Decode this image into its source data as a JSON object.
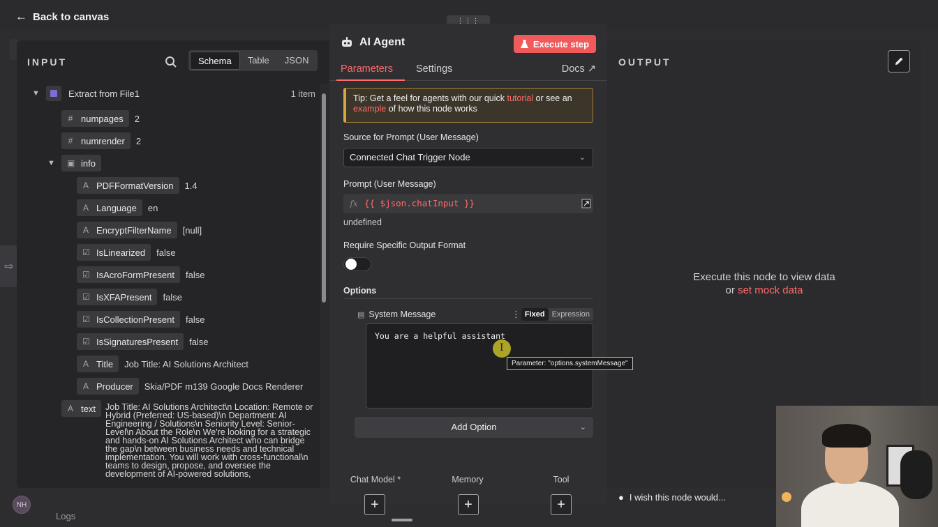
{
  "nav": {
    "back_label": "Back to canvas"
  },
  "input": {
    "title": "INPUT",
    "view_tabs": [
      "Schema",
      "Table",
      "JSON"
    ],
    "node_name": "Extract from File1",
    "item_count": "1 item",
    "fields": {
      "numpages": {
        "key": "numpages",
        "value": "2"
      },
      "numrender": {
        "key": "numrender",
        "value": "2"
      },
      "info": {
        "key": "info"
      },
      "pdfformat": {
        "key": "PDFFormatVersion",
        "value": "1.4"
      },
      "language": {
        "key": "Language",
        "value": "en"
      },
      "encrypt": {
        "key": "EncryptFilterName",
        "value": "[null]"
      },
      "linearized": {
        "key": "IsLinearized",
        "value": "false"
      },
      "acroform": {
        "key": "IsAcroFormPresent",
        "value": "false"
      },
      "xfa": {
        "key": "IsXFAPresent",
        "value": "false"
      },
      "collection": {
        "key": "IsCollectionPresent",
        "value": "false"
      },
      "signatures": {
        "key": "IsSignaturesPresent",
        "value": "false"
      },
      "title": {
        "key": "Title",
        "value": "Job Title: AI Solutions Architect"
      },
      "producer": {
        "key": "Producer",
        "value": "Skia/PDF m139 Google Docs Renderer"
      },
      "text": {
        "key": "text",
        "value": "Job Title: AI Solutions Architect\\n Location: Remote or Hybrid (Preferred: US-based)\\n Department: AI Engineering / Solutions\\n Seniority Level: Senior-Level\\n About the Role\\n We're looking for a strategic and hands-on AI Solutions Architect who can bridge the gap\\n between business needs and technical implementation. You will work with cross-functional\\n teams to design, propose, and oversee the development of AI-powered solutions,"
      }
    }
  },
  "output": {
    "title": "OUTPUT",
    "message_line1": "Execute this node to view data",
    "message_or": "or",
    "mock_link": "set mock data",
    "wish_label": "I wish this node would..."
  },
  "node": {
    "title": "AI Agent",
    "execute_label": "Execute step",
    "tabs": {
      "parameters": "Parameters",
      "settings": "Settings",
      "docs": "Docs"
    },
    "tip": {
      "prefix": "Tip: Get a feel for agents with our quick ",
      "tutorial_link": "tutorial",
      "middle": " or see an ",
      "example_link": "example",
      "suffix": " of how this node works"
    },
    "source_label": "Source for Prompt (User Message)",
    "source_value": "Connected Chat Trigger Node",
    "prompt_label": "Prompt (User Message)",
    "prompt_fx": "fx",
    "prompt_value": "{{ $json.chatInput }}",
    "prompt_result": "undefined",
    "output_format_label": "Require Specific Output Format",
    "options_label": "Options",
    "system_message_label": "System Message",
    "mode_fixed": "Fixed",
    "mode_expression": "Expression",
    "system_message_value": "You are a helpful assistant",
    "tooltip": "Parameter: \"options.systemMessage\"",
    "add_option_label": "Add Option",
    "sub_nodes": {
      "chat_model": "Chat Model *",
      "memory": "Memory",
      "tool": "Tool"
    }
  },
  "footer": {
    "avatar_initials": "NH",
    "logs_label": "Logs"
  },
  "colors": {
    "accent": "#ff6b6b",
    "execute": "#f05a5a",
    "tip_border": "#d9a441"
  }
}
